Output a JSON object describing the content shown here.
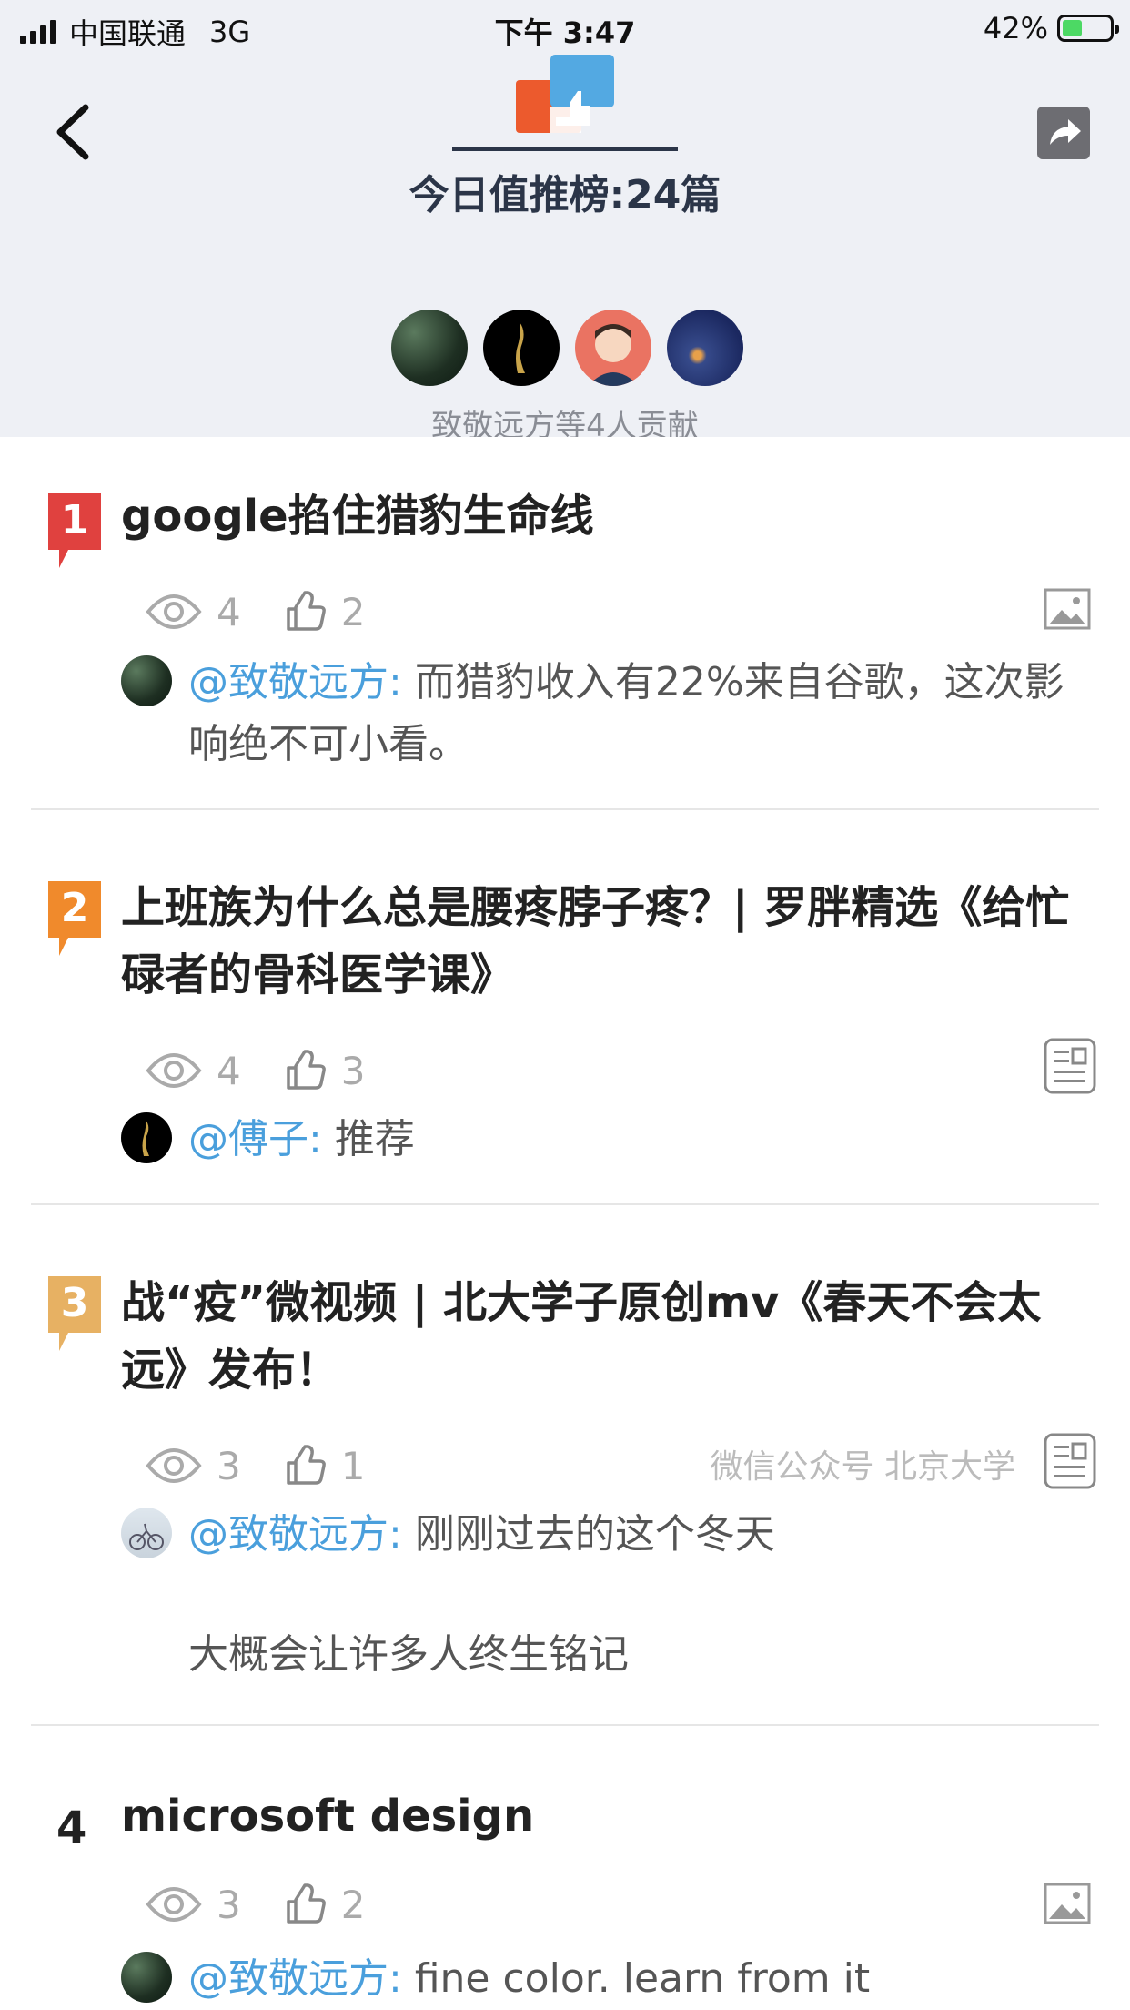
{
  "status_bar": {
    "carrier": "中国联通",
    "network": "3G",
    "time": "下午 3:47",
    "battery": "42%",
    "battery_level": 0.42
  },
  "header": {
    "title": "今日值推榜:24篇",
    "contributors_text": "致敬远方等4人贡献",
    "icons": {
      "back": "chevron-left-icon",
      "share": "share-icon",
      "logo": "thumbs-up-logo"
    }
  },
  "items": [
    {
      "rank": "1",
      "title": "google掐住猎豹生命线",
      "views": "4",
      "likes": "2",
      "type_icon": "image-icon",
      "source": "",
      "comment_user": "@致敬远方:",
      "comment_text": "而猎豹收入有22%来自谷歌，这次影响绝不可小看。",
      "comment_text_2": ""
    },
    {
      "rank": "2",
      "title": "上班族为什么总是腰疼脖子疼？| 罗胖精选《给忙碌者的骨科医学课》",
      "views": "4",
      "likes": "3",
      "type_icon": "article-icon",
      "source": "",
      "comment_user": "@傅子:",
      "comment_text": "推荐",
      "comment_text_2": ""
    },
    {
      "rank": "3",
      "title": "战“疫”微视频 | 北大学子原创mv《春天不会太远》发布！",
      "views": "3",
      "likes": "1",
      "type_icon": "article-icon",
      "source": "微信公众号 北京大学",
      "comment_user": "@致敬远方:",
      "comment_text": "刚刚过去的这个冬天",
      "comment_text_2": "大概会让许多人终生铭记"
    },
    {
      "rank": "4",
      "title": "microsoft design",
      "views": "3",
      "likes": "2",
      "type_icon": "image-icon",
      "source": "",
      "comment_user": "@致敬远方:",
      "comment_text": "fine color. learn from it",
      "comment_text_2": ""
    }
  ],
  "colors": {
    "rank1": "#e0413f",
    "rank2": "#f08a2c",
    "rank3": "#e7b163",
    "link": "#4a9fdc",
    "header_bg": "#eef0f5"
  }
}
